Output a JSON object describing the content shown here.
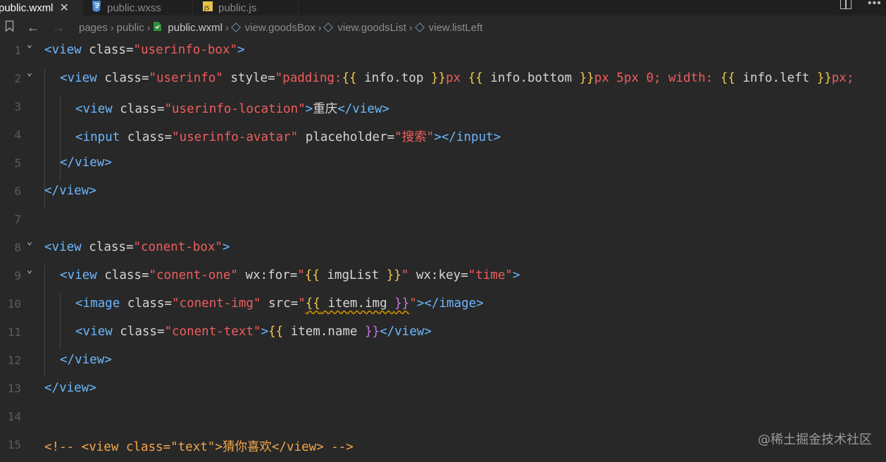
{
  "tabs": [
    {
      "label": "public.wxml",
      "close": "✕",
      "icon": "wxml-file-icon",
      "active": true
    },
    {
      "label": "public.wxss",
      "icon": "css-file-icon",
      "active": false
    },
    {
      "label": "public.js",
      "icon": "js-file-icon",
      "active": false
    }
  ],
  "breadcrumb": {
    "back": "←",
    "forward": "→",
    "items": [
      "pages",
      "public",
      "public.wxml",
      "view.goodsBox",
      "view.goodsList",
      "view.listLeft"
    ]
  },
  "editor": {
    "line_numbers": [
      "1",
      "2",
      "3",
      "4",
      "5",
      "6",
      "7",
      "8",
      "9",
      "10",
      "11",
      "12",
      "13",
      "14",
      "15"
    ],
    "fold_marker": "⌄"
  },
  "code": {
    "l1": {
      "lt": "<",
      "tag": "view",
      "cls": "class",
      "eq": "=",
      "val": "\"userinfo-box\"",
      "gt": ">"
    },
    "l2": {
      "lt": "<",
      "tag": "view",
      "cls": "class",
      "eq": "=",
      "val": "\"userinfo\"",
      "sty": "style",
      "eq2": "=",
      "q": "\"padding:",
      "o1": "{{",
      "v1": " info.top ",
      "c1": "}}",
      "px1": "px ",
      "o2": "{{",
      "v2": " info.bottom ",
      "c2": "}}",
      "px2": "px 5px 0; width: ",
      "o3": "{{",
      "v3": " info.left ",
      "c3": "}}",
      "px3": "px;"
    },
    "l3": {
      "lt": "<",
      "tag": "view",
      "cls": "class",
      "eq": "=",
      "val": "\"userinfo-location\"",
      "gt": ">",
      "text": "重庆",
      "close": "</view>"
    },
    "l4": {
      "lt": "<",
      "tag": "input",
      "cls": "class",
      "eq": "=",
      "val": "\"userinfo-avatar\"",
      "ph": "placeholder",
      "eq2": "=",
      "val2": "\"搜索\"",
      "gt": ">",
      "close": "</input>"
    },
    "l5": {
      "close": "</view>"
    },
    "l6": {
      "close": "</view>"
    },
    "l8": {
      "lt": "<",
      "tag": "view",
      "cls": "class",
      "eq": "=",
      "val": "\"conent-box\"",
      "gt": ">"
    },
    "l9": {
      "lt": "<",
      "tag": "view",
      "cls": "class",
      "eq": "=",
      "val": "\"conent-one\"",
      "for": "wx:for",
      "eq2": "=",
      "q1": "\"",
      "o1": "{{",
      "v1": " imgList ",
      "c1": "}}",
      "q2": "\"",
      "key": "wx:key",
      "eq3": "=",
      "val3": "\"time\"",
      "gt": ">"
    },
    "l10": {
      "lt": "<",
      "tag": "image",
      "cls": "class",
      "eq": "=",
      "val": "\"conent-img\"",
      "src": "src",
      "eq2": "=",
      "q1": "\"",
      "o1": "{{",
      "v1": " item.img ",
      "c1": "}}",
      "q2": "\"",
      "gt": ">",
      "close": "</image>"
    },
    "l11": {
      "lt": "<",
      "tag": "view",
      "cls": "class",
      "eq": "=",
      "val": "\"conent-text\"",
      "gt": ">",
      "o1": "{{",
      "v1": " item.name ",
      "c1": "}}",
      "close": "</view>"
    },
    "l12": {
      "close": "</view>"
    },
    "l13": {
      "close": "</view>"
    },
    "l15": {
      "comment": "<!-- <view class=\"text\">猜你喜欢</view> -->"
    }
  },
  "watermark": "@稀土掘金技术社区"
}
